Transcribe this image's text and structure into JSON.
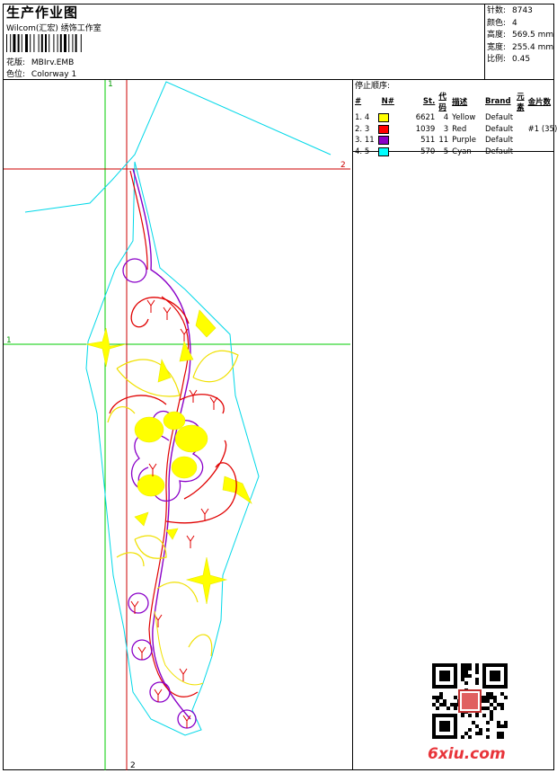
{
  "header": {
    "title": "生产作业图",
    "company": "Wilcom(汇宏) 绣饰工作室",
    "design_label": "花版:",
    "design_value": "MBIrv.EMB",
    "colorway_label": "色位:",
    "colorway_value": "Colorway 1"
  },
  "stats": [
    {
      "label": "针数:",
      "value": "8743"
    },
    {
      "label": "颜色:",
      "value": "4"
    },
    {
      "label": "高度:",
      "value": "569.5 mm"
    },
    {
      "label": "宽度:",
      "value": "255.4 mm"
    },
    {
      "label": "比例:",
      "value": "0.45"
    }
  ],
  "stop_sequence": {
    "heading": "停止顺序:",
    "columns": [
      "#",
      "N#",
      "St.",
      "代码",
      "描述",
      "Brand",
      "元素",
      "金片数"
    ],
    "rows": [
      {
        "idx": "1.",
        "n": "4",
        "color": "#ffff00",
        "st": "6621",
        "code": "4",
        "desc": "Yellow",
        "brand": "Default",
        "elem": "",
        "seq": ""
      },
      {
        "idx": "2.",
        "n": "3",
        "color": "#ff0000",
        "st": "1039",
        "code": "3",
        "desc": "Red",
        "brand": "Default",
        "elem": "",
        "seq": "#1 (35)"
      },
      {
        "idx": "3.",
        "n": "11",
        "color": "#8a00c8",
        "st": "511",
        "code": "11",
        "desc": "Purple",
        "brand": "Default",
        "elem": "",
        "seq": ""
      },
      {
        "idx": "4.",
        "n": "5",
        "color": "#00ffff",
        "st": "570",
        "code": "5",
        "desc": "Cyan",
        "brand": "Default",
        "elem": "",
        "seq": ""
      }
    ]
  },
  "axes": {
    "v1_top": "1",
    "v1_left": "1",
    "h2_right": "2",
    "h2_bottom": "2"
  },
  "colors": {
    "guide_green": "#00cc00",
    "guide_red": "#cc0000",
    "outline_cyan": "#00d8e8",
    "thread_yellow": "#ffff00",
    "thread_red": "#e00000",
    "thread_purple": "#8a00c8"
  },
  "watermark": {
    "text": "6xiu.com"
  }
}
